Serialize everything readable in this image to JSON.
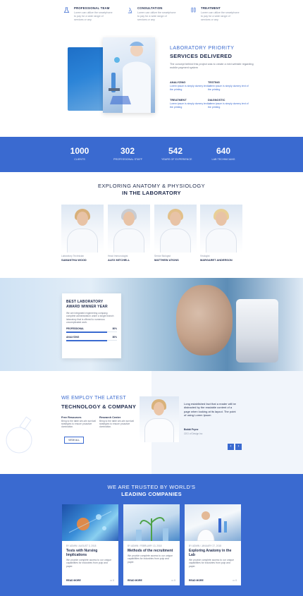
{
  "features": [
    {
      "icon": "flask-icon",
      "title": "Professional Team",
      "desc": "Lorem can utilize the smartphone to pay for a wide range of services or any"
    },
    {
      "icon": "microscope-icon",
      "title": "Consultation",
      "desc": "Lorem can utilize the smartphone to pay for a wide range of services or any"
    },
    {
      "icon": "testtube-icon",
      "title": "Treatment",
      "desc": "Lorem can utilize the smartphone to pay for a wide range of services or any"
    }
  ],
  "priority": {
    "title1": "LABORATORY PRIORITY",
    "title2": "SERVICES DELIVERED",
    "desc": "The concept behind this project was to create a mini website regarding mobile payment system",
    "services": [
      {
        "title": "Analyzing",
        "desc": "Lorem ipsum is simply dummy text of the printing"
      },
      {
        "title": "Testing",
        "desc": "Lorem ipsum is simply dummy text of the printing"
      },
      {
        "title": "Treatment",
        "desc": "Lorem ipsum is simply dummy text of the printing"
      },
      {
        "title": "Diagnostic",
        "desc": "Lorem ipsum is simply dummy text of the printing"
      }
    ]
  },
  "stats": [
    {
      "value": "1000",
      "label": "Clients"
    },
    {
      "value": "302",
      "label": "Professional Staff"
    },
    {
      "value": "542",
      "label": "Years of Experience"
    },
    {
      "value": "640",
      "label": "Lab Technicians"
    }
  ],
  "team": {
    "title1": "EXPLORING ANATOMY & PHYSIOLOGY",
    "title2": "IN THE LABORATORY",
    "members": [
      {
        "role": "Laboratory Technician",
        "name": "Samantha Wood",
        "hair": "#d8b07a"
      },
      {
        "role": "Head Immunologist",
        "name": "Alex Mitchell",
        "hair": "#c9ccd2"
      },
      {
        "role": "Senior Biologist",
        "name": "Matthew Atkins",
        "hair": "#e2c08a"
      },
      {
        "role": "Virologist",
        "name": "Margaret Anderson",
        "hair": "#e8cf96"
      }
    ]
  },
  "award": {
    "title1": "BEST LABORATORY",
    "title2": "AWARD WINNER YEAR",
    "desc": "We are integrated engineering company, complete administration under a single branch laboratory that is offered to numerous uncomplicated work.",
    "bars": [
      {
        "label": "Professional",
        "value": "80%",
        "fraction": 0.8
      },
      {
        "label": "Analyzing",
        "value": "80%",
        "fraction": 0.8
      }
    ]
  },
  "tech": {
    "title1": "WE EMPLOY THE LATEST",
    "title2": "TECHNOLOGY & COMPANY",
    "cols": [
      {
        "title": "Free Resources",
        "desc": "Bring to the table win-win survival strategies to ensure proactive domination."
      },
      {
        "title": "Research Center",
        "desc": "Bring to the table win-win survival strategies to ensure proactive domination."
      }
    ],
    "view_all": "View All",
    "testimonial": {
      "text": "Long established fact that a reader will be distracted by the readable content of a page when looking at its layout. The point of using Lorem Ipsum",
      "name": "Bobbi Fryne",
      "role": "CEO of Design Inc"
    },
    "prev": "‹",
    "next": "›"
  },
  "trusted": {
    "title1": "WE ARE TRUSTED BY WORLD'S",
    "title2": "LEADING COMPANIES",
    "posts": [
      {
        "meta": "By Admin / August 3, 2018",
        "title": "Tests with Nursing Implications",
        "desc": "We provide complete access to our unique capabilities for industries from pulp and paper.",
        "read": "Read More",
        "comments": "0"
      },
      {
        "meta": "By Admin / February 13, 2018",
        "title": "Methods of the recruitment",
        "desc": "We provide complete access to our unique capabilities for industries from pulp and paper.",
        "read": "Read More",
        "comments": "0"
      },
      {
        "meta": "By Admin / January 27, 2018",
        "title": "Exploring Anatomy in the Lab",
        "desc": "We provide complete access to our unique capabilities for industries from pulp and paper.",
        "read": "Read More",
        "comments": "0"
      }
    ]
  },
  "colors": {
    "accent": "#3a6ad0",
    "dark": "#1f2b4d"
  }
}
